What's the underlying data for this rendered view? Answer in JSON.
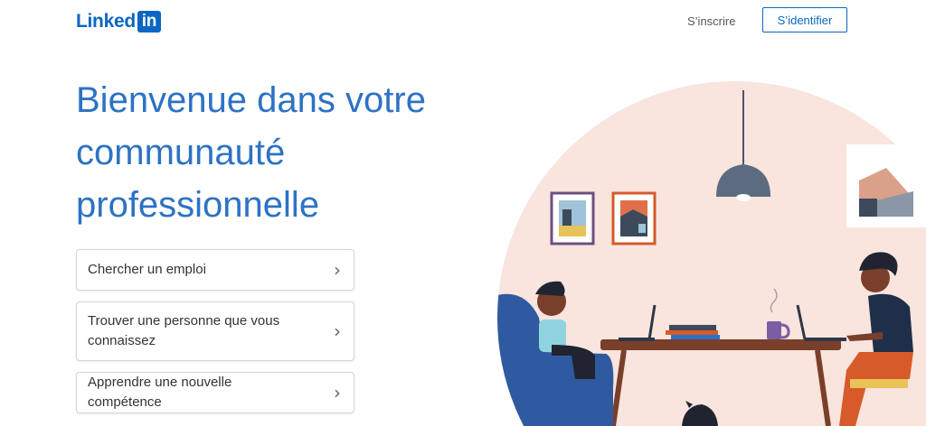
{
  "header": {
    "logo_text": "Linked",
    "logo_badge": "in",
    "join_label": "S’inscrire",
    "signin_label": "S’identifier"
  },
  "hero": {
    "title": "Bienvenue dans votre communauté professionnelle"
  },
  "cards": [
    {
      "label": "Chercher un emploi"
    },
    {
      "label": "Trouver une personne que vous connaissez"
    },
    {
      "label": "Apprendre une nouvelle compétence"
    }
  ],
  "icons": {
    "chevron": "chevron-right-icon"
  },
  "colors": {
    "brand": "#0a66c2",
    "headline": "#2d72c4",
    "illustration_bg": "#f9e4de"
  }
}
